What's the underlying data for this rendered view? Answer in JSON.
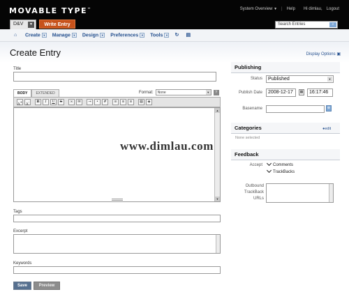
{
  "app": {
    "logo": "MOVABLE TYPE",
    "logo_tm": "™"
  },
  "topnav": {
    "system_overview": "System Overview",
    "help": "Help",
    "greeting": "Hi dimlau,",
    "logout": "Logout"
  },
  "blog": {
    "name": "D&V",
    "write_entry": "Write Entry"
  },
  "search": {
    "value": "Search  Entries"
  },
  "menu": {
    "items": [
      "Create",
      "Manage",
      "Design",
      "Preferences",
      "Tools"
    ]
  },
  "page": {
    "title": "Create Entry",
    "display_options": "Display Options"
  },
  "editor": {
    "title_label": "Title",
    "tab_body": "BODY",
    "tab_extended": "EXTENDED",
    "format_label": "Format:",
    "format_value": "None",
    "help": "?",
    "toolbar": [
      "A+",
      "A-",
      "B",
      "I",
      "U",
      "S",
      "link",
      "mail",
      "indent",
      "ul",
      "ol",
      "left",
      "center",
      "right",
      "img",
      "file"
    ]
  },
  "fields": {
    "tags": "Tags",
    "excerpt": "Excerpt",
    "keywords": "Keywords"
  },
  "actions": {
    "save": "Save",
    "preview": "Preview"
  },
  "publishing": {
    "header": "Publishing",
    "status_label": "Status",
    "status_value": "Published",
    "publish_date_label": "Publish Date",
    "date": "2008-12-17",
    "time": "16:17:46",
    "basename_label": "Basename"
  },
  "categories": {
    "header": "Categories",
    "edit": "edit",
    "none_selected": "None selected"
  },
  "feedback": {
    "header": "Feedback",
    "accept_label": "Accept",
    "comments": "Comments",
    "trackbacks": "TrackBacks",
    "outbound_label_1": "Outbound",
    "outbound_label_2": "TrackBack",
    "outbound_label_3": "URLs"
  },
  "watermark": "www.dimlau.com",
  "colors": {
    "topbar": "#050505",
    "write_button": "#c7521b",
    "link": "#26518f",
    "save_button": "#56708f"
  }
}
